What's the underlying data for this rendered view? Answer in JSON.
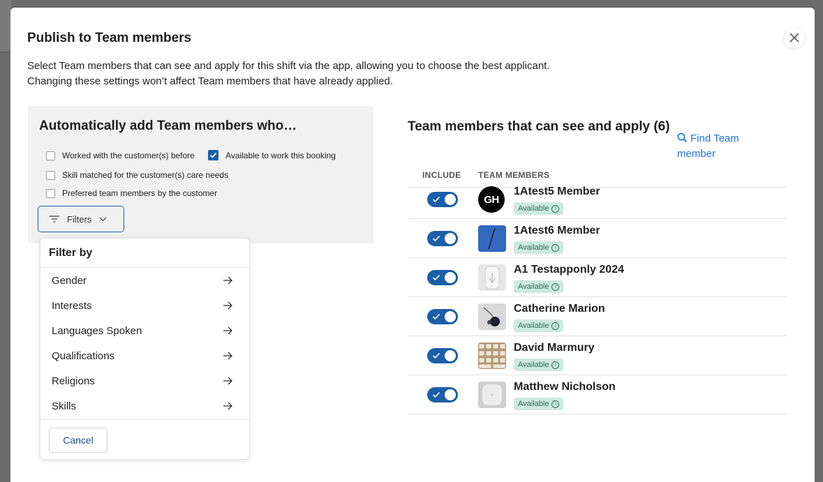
{
  "modal": {
    "title": "Publish to Team members",
    "subtitle_line1": "Select Team members that can see and apply for this shift via the app, allowing you to choose the best applicant.",
    "subtitle_line2": "Changing these settings won’t affect Team members that have already applied."
  },
  "auto_add": {
    "title": "Automatically add Team members who…",
    "options": [
      {
        "label": "Worked with the customer(s) before",
        "checked": false
      },
      {
        "label": "Available to work this booking",
        "checked": true
      },
      {
        "label": "Skill matched for the customer(s) care needs",
        "checked": false
      },
      {
        "label": "Preferred team members by the customer",
        "checked": false
      }
    ],
    "filters_label": "Filters"
  },
  "filter_dropdown": {
    "heading": "Filter by",
    "items": [
      "Gender",
      "Interests",
      "Languages Spoken",
      "Qualifications",
      "Religions",
      "Skills"
    ],
    "cancel_label": "Cancel"
  },
  "team": {
    "title": "Team members that can see and apply (6)",
    "find_label": "Find Team member",
    "col_include": "INCLUDE",
    "col_members": "TEAM MEMBERS",
    "members": [
      {
        "name": "1Atest5 Member",
        "status": "Available",
        "included": true,
        "avatar_initials": "GH"
      },
      {
        "name": "1Atest6 Member",
        "status": "Available",
        "included": true
      },
      {
        "name": "A1 Testapponly 2024",
        "status": "Available",
        "included": true
      },
      {
        "name": "Catherine Marion",
        "status": "Available",
        "included": true
      },
      {
        "name": "David Marmury",
        "status": "Available",
        "included": true
      },
      {
        "name": "Matthew Nicholson",
        "status": "Available",
        "included": true
      }
    ]
  },
  "colors": {
    "accent": "#1b5fa8",
    "link": "#1f73d6",
    "badge_bg": "#cde9e0",
    "badge_text": "#2d6e58"
  }
}
